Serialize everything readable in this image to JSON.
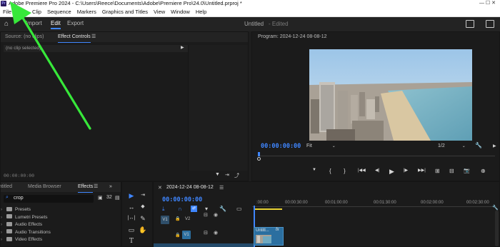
{
  "window": {
    "title": "Adobe Premiere Pro 2024 - C:\\Users\\Reece\\Documents\\Adobe\\Premiere Pro\\24.0\\Untitled.prproj *",
    "app_icon": "Pr",
    "controls": "—     ☐     ✕"
  },
  "menu": [
    "File",
    "Edit",
    "Clip",
    "Sequence",
    "Markers",
    "Graphics and Titles",
    "View",
    "Window",
    "Help"
  ],
  "workspace": {
    "tabs": [
      "Import",
      "Edit",
      "Export"
    ],
    "active_tab": "Edit",
    "project_title": "Untitled",
    "project_status": "- Edited",
    "home_label": "⌂"
  },
  "source_panel": {
    "tab_source": "Source: (no clips)",
    "tab_effect_controls": "Effect Controls",
    "menu_icon": "☰",
    "no_clip": "(no clip selected)",
    "play_arrow": "▶",
    "timecode": "00:00:00:00"
  },
  "program_panel": {
    "title": "Program: 2024-12-24 08-08-12",
    "timecode": "00:00:00:00",
    "fit": "Fit",
    "fraction": "1/2",
    "wrench": "🔧",
    "transport": [
      "▼",
      "{",
      "}",
      "|◀◀",
      "◀|",
      "▶",
      "|▶",
      "▶▶|",
      "⊞",
      "⊟",
      "📷",
      "⊕"
    ]
  },
  "effects_panel": {
    "tab_left": "Untitled",
    "tab_media": "Media Browser",
    "tab_effects": "Effects",
    "search_value": "crop",
    "items": [
      "Presets",
      "Lumetri Presets",
      "Audio Effects",
      "Audio Transitions",
      "Video Effects"
    ]
  },
  "tools": [
    "▶",
    "⇥",
    "↔",
    "◆",
    "|↔|",
    "✎",
    "▭",
    "✋",
    "T"
  ],
  "timeline": {
    "tab_close": "✕",
    "sequence_name": "2024-12-24 08-08-12",
    "menu_icon": "☰",
    "timecode": "00:00:00:00",
    "ruler": [
      ":00:00",
      "00:00:30:00",
      "00:01:00:00",
      "00:01:30:00",
      "00:02:00:00",
      "00:02:30:00"
    ],
    "tracks": [
      {
        "label": "V1",
        "name": "V2"
      },
      {
        "label": "",
        "name": "V1"
      }
    ],
    "clip_name": "Untitl...",
    "clip_fx": "fx"
  },
  "colors": {
    "accent": "#3f86ff",
    "arrow": "#37e83a",
    "clip": "#2b6fa0"
  }
}
